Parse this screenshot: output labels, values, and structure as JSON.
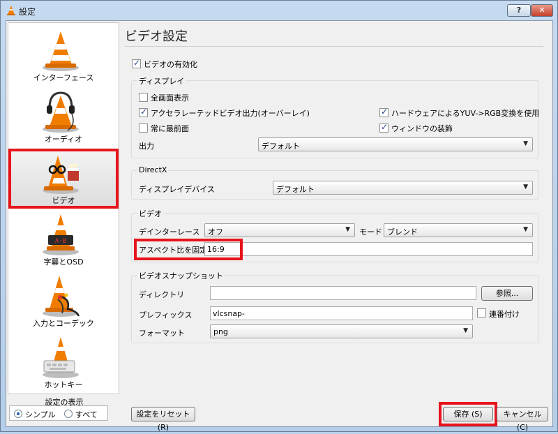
{
  "window": {
    "title": "設定",
    "help_button": "?",
    "close_button": "✕"
  },
  "sidebar": {
    "items": [
      {
        "label": "インターフェース",
        "icon": "vlc-cone-icon"
      },
      {
        "label": "オーディオ",
        "icon": "vlc-cone-headphones-icon"
      },
      {
        "label": "ビデオ",
        "icon": "vlc-cone-glasses-icon",
        "selected": true
      },
      {
        "label": "字幕とOSD",
        "icon": "vlc-cone-subtitle-icon"
      },
      {
        "label": "入力とコーデック",
        "icon": "vlc-cone-cables-icon"
      },
      {
        "label": "ホットキー",
        "icon": "vlc-cone-keyboard-icon"
      }
    ],
    "settings_show_label": "設定の表示",
    "scope": {
      "simple": "シンプル",
      "all": "すべて",
      "selected": "simple"
    }
  },
  "panel": {
    "title": "ビデオ設定",
    "enable_video": {
      "label": "ビデオの有効化",
      "checked": true
    },
    "display": {
      "title": "ディスプレイ",
      "fullscreen": {
        "label": "全画面表示",
        "checked": false
      },
      "accelerated": {
        "label": "アクセラレーテッドビデオ出力(オーバーレイ)",
        "checked": true
      },
      "always_on_top": {
        "label": "常に最前面",
        "checked": false
      },
      "hw_yuv": {
        "label": "ハードウェアによるYUV->RGB変換を使用",
        "checked": true
      },
      "window_decorations": {
        "label": "ウィンドウの装飾",
        "checked": true
      },
      "output_label": "出力",
      "output_value": "デフォルト"
    },
    "directx": {
      "title": "DirectX",
      "device_label": "ディスプレイデバイス",
      "device_value": "デフォルト"
    },
    "video": {
      "title": "ビデオ",
      "deinterlace_label": "デインターレース",
      "deinterlace_value": "オフ",
      "mode_label": "モード",
      "mode_value": "ブレンド",
      "aspect_label": "アスペクト比を固定",
      "aspect_value": "16:9"
    },
    "snapshot": {
      "title": "ビデオスナップショット",
      "dir_label": "ディレクトリ",
      "dir_value": "",
      "browse_button": "参照...",
      "prefix_label": "プレフィックス",
      "prefix_value": "vlcsnap-",
      "sequential_label": "連番付け",
      "sequential_checked": false,
      "format_label": "フォーマット",
      "format_value": "png"
    }
  },
  "footer": {
    "reset_button": "設定をリセット (R)",
    "save_button": "保存 (S)",
    "cancel_button": "キャンセル (C)"
  },
  "colors": {
    "highlight": "#e8141c",
    "cone_orange": "#f07d00"
  }
}
